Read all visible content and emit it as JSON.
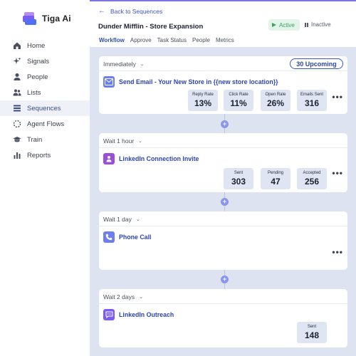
{
  "brand": {
    "name": "Tiga Ai"
  },
  "sidebar": {
    "items": [
      {
        "label": "Home",
        "icon": "home-icon"
      },
      {
        "label": "Signals",
        "icon": "sparkle-icon"
      },
      {
        "label": "People",
        "icon": "person-icon"
      },
      {
        "label": "Lists",
        "icon": "people-group-icon"
      },
      {
        "label": "Sequences",
        "icon": "stack-icon",
        "active": true
      },
      {
        "label": "Agent Flows",
        "icon": "dashed-circle-icon"
      },
      {
        "label": "Train",
        "icon": "graduation-cap-icon"
      },
      {
        "label": "Reports",
        "icon": "bar-chart-icon"
      }
    ]
  },
  "header": {
    "back_label": "Back to Sequences",
    "title": "Dunder Mifflin - Store Expansion",
    "status_active": "Active",
    "status_inactive": "Inactive",
    "tabs": [
      "Workflow",
      "Approve",
      "Task Status",
      "People",
      "Metrics"
    ],
    "active_tab": "Workflow"
  },
  "steps": [
    {
      "delay": "Immediately",
      "badge": "30 Upcoming",
      "title": "Send Email - Your New Store in {{new store location}}",
      "icon": "email-icon",
      "stats": [
        {
          "label": "Reply Rate",
          "value": "13%"
        },
        {
          "label": "Click Rate",
          "value": "11%"
        },
        {
          "label": "Open Rate",
          "value": "26%"
        },
        {
          "label": "Emails Sent",
          "value": "316"
        }
      ]
    },
    {
      "delay": "Wait 1 hour",
      "title": "LinkedIn Connection Invite",
      "icon": "linkedin-person-icon",
      "stats": [
        {
          "label": "Sent",
          "value": "303"
        },
        {
          "label": "Pending",
          "value": "47"
        },
        {
          "label": "Accepted",
          "value": "256"
        }
      ]
    },
    {
      "delay": "Wait 1 day",
      "title": "Phone Call",
      "icon": "phone-icon",
      "stats": []
    },
    {
      "delay": "Wait 2 days",
      "title": "LinkedIn Outreach",
      "icon": "chat-bubble-icon",
      "stats": [
        {
          "label": "Sent",
          "value": "148"
        }
      ]
    }
  ],
  "colors": {
    "accent": "#3a56c5",
    "canvas": "#dde3f0",
    "active_status": "#3a9c5a",
    "email_icon_bg": "#6b7ff0",
    "linkedin_icon_bg": "#9b4fd8",
    "phone_icon_bg": "#6b7ff0",
    "chat_icon_bg": "#7a5cf0"
  }
}
